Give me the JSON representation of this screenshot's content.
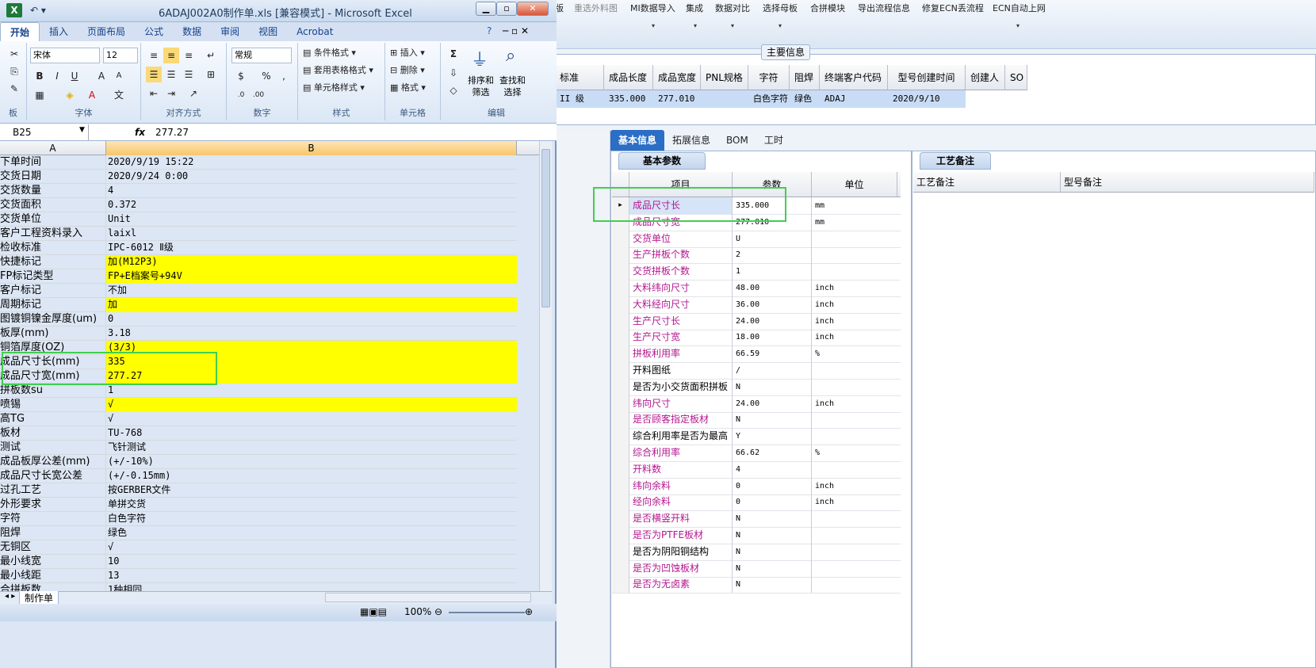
{
  "excel": {
    "title": "6ADAJ002A0制作单.xls  [兼容模式] - Microsoft Excel",
    "tabs": [
      "开始",
      "插入",
      "页面布局",
      "公式",
      "数据",
      "审阅",
      "视图",
      "Acrobat"
    ],
    "ribbon": {
      "font_name": "宋体",
      "font_size": "12",
      "number_format": "常规",
      "styles": [
        "条件格式",
        "套用表格格式",
        "单元格样式"
      ],
      "cells": [
        "插入",
        "删除",
        "格式"
      ],
      "sort_filter": "排序和\n筛选",
      "find_select": "查找和\n选择",
      "groups": [
        "字体",
        "对齐方式",
        "数字",
        "样式",
        "单元格",
        "编辑"
      ],
      "clipboard_label": "板"
    },
    "name_box": "B25",
    "fx": "fx",
    "formula_value": "277.27",
    "col_a": "A",
    "col_b": "B",
    "rows": [
      [
        "下单时间",
        "2020/9/19 15:22",
        false
      ],
      [
        "交货日期",
        "2020/9/24 0:00",
        false
      ],
      [
        "交货数量",
        "4",
        false
      ],
      [
        "交货面积",
        "0.372",
        false
      ],
      [
        "交货单位",
        "Unit",
        false
      ],
      [
        "客户工程资料录入",
        "laixl",
        false
      ],
      [
        "检收标准",
        "IPC-6012 Ⅱ级",
        false
      ],
      [
        "快捷标记",
        "加(M12P3)",
        true
      ],
      [
        "FP标记类型",
        "FP+E档案号+94V",
        true
      ],
      [
        "客户标记",
        "不加",
        false
      ],
      [
        "周期标记",
        "加",
        true
      ],
      [
        "图镀铜镍金厚度(um)",
        "0",
        false
      ],
      [
        "板厚(mm)",
        "3.18",
        false
      ],
      [
        "铜箔厚度(OZ)",
        "  (3/3)",
        true
      ],
      [
        "成品尺寸长(mm)",
        "335",
        true
      ],
      [
        "成品尺寸宽(mm)",
        "277.27",
        true
      ],
      [
        "拼板数su",
        "1",
        false
      ],
      [
        "喷锡",
        "√",
        true
      ],
      [
        "高TG",
        "√",
        false
      ],
      [
        "板材",
        "TU-768",
        false
      ],
      [
        "测试",
        "飞针测试",
        false
      ],
      [
        "成品板厚公差(mm)",
        "(+/-10%)",
        false
      ],
      [
        "成品尺寸长宽公差",
        "(+/-0.15mm)",
        false
      ],
      [
        "过孔工艺",
        "按GERBER文件",
        false
      ],
      [
        "外形要求",
        "单拼交货",
        false
      ],
      [
        "字符",
        "白色字符",
        false
      ],
      [
        "阻焊",
        "绿色",
        false
      ],
      [
        "无铜区",
        "√",
        false
      ],
      [
        "最小线宽",
        "10",
        false
      ],
      [
        "最小线距",
        "13",
        false
      ],
      [
        "合拼板数",
        "1种相同",
        false
      ]
    ],
    "sheet_tab": "制作单",
    "zoom": "100%"
  },
  "app": {
    "toolbar": [
      "版",
      "重选外料图",
      "MI数据导入",
      "集成",
      "数据对比",
      "选择母板",
      "合拼模块",
      "导出流程信息",
      "修复ECN丢流程",
      "ECN自动上网"
    ],
    "main_legend": "主要信息",
    "grid_headers": [
      "标准",
      "成品长度",
      "成品宽度",
      "PNL规格",
      "字符",
      "阻焊",
      "终端客户代码",
      "型号创建时间",
      "创建人",
      "SO"
    ],
    "grid_row": [
      "II 级",
      "335.000",
      "277.010",
      "",
      "白色字符",
      "绿色",
      "ADAJ",
      "2020/9/10",
      "",
      ""
    ],
    "tabs": [
      "基本信息",
      "拓展信息",
      "BOM",
      "工时"
    ],
    "params_tab": "基本参数",
    "params_headers": [
      "项目",
      "参数",
      "单位"
    ],
    "params": [
      [
        "成品尺寸长",
        "335.000",
        "mm",
        true
      ],
      [
        "成品尺寸宽",
        "277.010",
        "mm",
        true
      ],
      [
        "交货单位",
        "U",
        "",
        true
      ],
      [
        "生产拼板个数",
        "2",
        "",
        true
      ],
      [
        "交货拼板个数",
        "1",
        "",
        true
      ],
      [
        "大料纬向尺寸",
        "48.00",
        "inch",
        true
      ],
      [
        "大料经向尺寸",
        "36.00",
        "inch",
        true
      ],
      [
        "生产尺寸长",
        "24.00",
        "inch",
        true
      ],
      [
        "生产尺寸宽",
        "18.00",
        "inch",
        true
      ],
      [
        "拼板利用率",
        "66.59",
        "%",
        true
      ],
      [
        "开料图纸",
        "/",
        "",
        false
      ],
      [
        "是否为小交货面积拼板",
        "N",
        "",
        false
      ],
      [
        "纬向尺寸",
        "24.00",
        "inch",
        true
      ],
      [
        "是否顾客指定板材",
        "N",
        "",
        true
      ],
      [
        "综合利用率是否为最高",
        "Y",
        "",
        false
      ],
      [
        "综合利用率",
        "66.62",
        "%",
        true
      ],
      [
        "开料数",
        "4",
        "",
        true
      ],
      [
        "纬向余料",
        "0",
        "inch",
        true
      ],
      [
        "经向余料",
        "0",
        "inch",
        true
      ],
      [
        "是否横竖开料",
        "N",
        "",
        true
      ],
      [
        "是否为PTFE板材",
        "N",
        "",
        true
      ],
      [
        "是否为阴阳铜结构",
        "N",
        "",
        false
      ],
      [
        "是否为凹蚀板材",
        "N",
        "",
        true
      ],
      [
        "是否为无卤素",
        "N",
        "",
        true
      ]
    ],
    "right_tab": "工艺备注",
    "right_headers": [
      "工艺备注",
      "型号备注"
    ]
  },
  "colors": {
    "highlight": "#ffff00",
    "accent": "#2b6ec6",
    "param_key": "#b3188f",
    "green_box": "#3fcf4f"
  }
}
